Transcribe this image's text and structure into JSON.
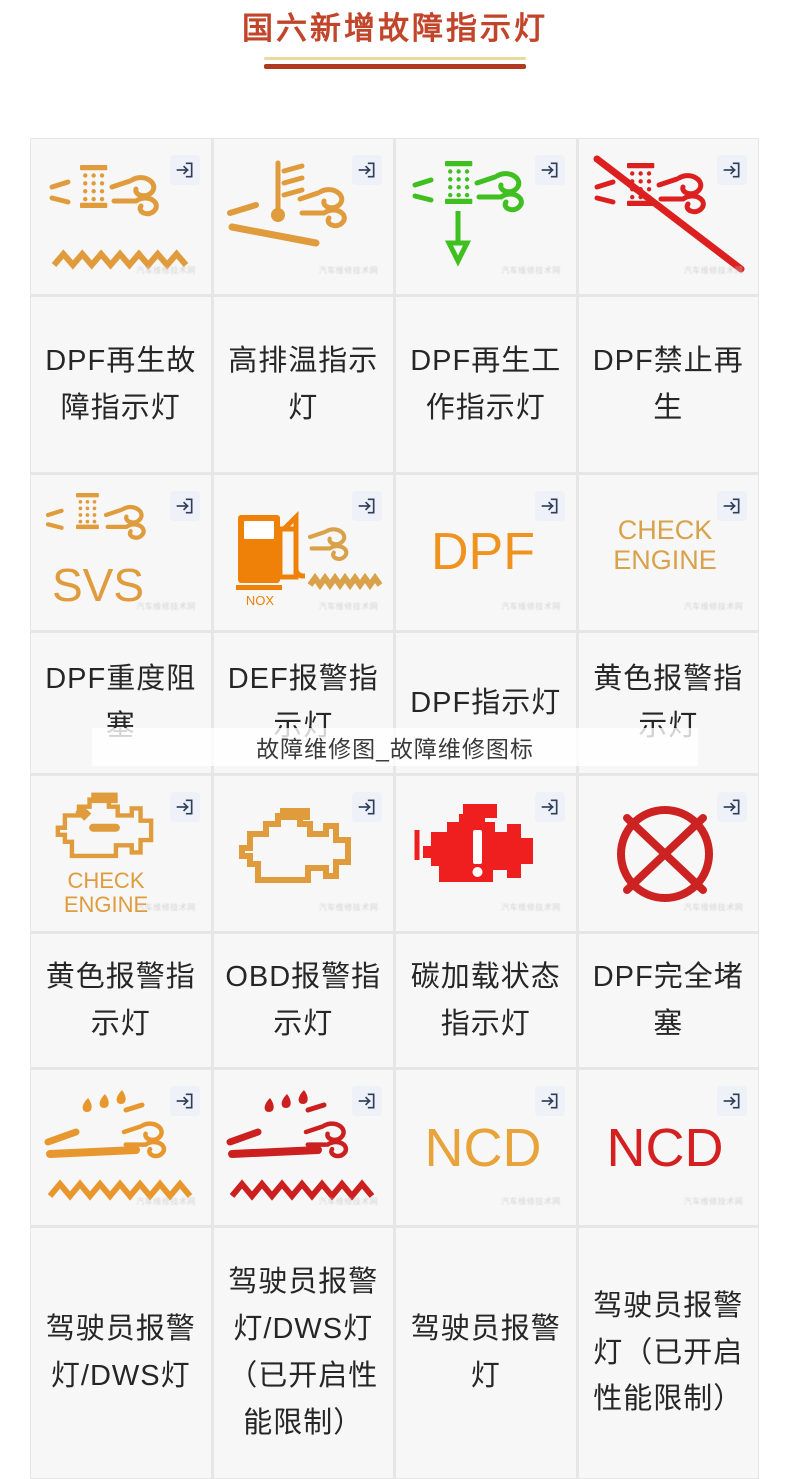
{
  "header": {
    "title": "国六新增故障指示灯",
    "accent_color": "#c1452a",
    "rule_top_color": "#ecd9a0",
    "rule_bottom_color": "#b03a20"
  },
  "overlay": {
    "text": "故障维修图_故障维修图标"
  },
  "watermark": {
    "text": "汽车维修技术网"
  },
  "icons": {
    "corner_badge_name": "import-arrow-icon"
  },
  "grid": {
    "columns": 4,
    "cells": [
      {
        "id": "r1c1",
        "label": "DPF再生故障指示灯",
        "icon": "dpf-filter-regen-fault-icon",
        "color": "#e09b3d"
      },
      {
        "id": "r1c2",
        "label": "高排温指示灯",
        "icon": "high-exhaust-temp-icon",
        "color": "#e09b3d"
      },
      {
        "id": "r1c3",
        "label": "DPF再生工作指示灯",
        "icon": "dpf-regen-active-icon",
        "color": "#3fbf20"
      },
      {
        "id": "r1c4",
        "label": "DPF禁止再生",
        "icon": "dpf-regen-inhibit-icon",
        "color": "#dc2020"
      },
      {
        "id": "r2c1",
        "label": "DPF重度阻塞",
        "icon": "svs-icon",
        "color": "#e09b3d",
        "text": "SVS"
      },
      {
        "id": "r2c2",
        "label": "DEF报警指示灯",
        "icon": "nox-def-pump-icon",
        "color": "#ef8008",
        "text": "NOX"
      },
      {
        "id": "r2c3",
        "label": "DPF指示灯",
        "icon": "dpf-text-icon",
        "color": "#f0921e",
        "text": "DPF"
      },
      {
        "id": "r2c4",
        "label": "黄色报警指示灯",
        "icon": "check-engine-text-icon",
        "color": "#d9a24a",
        "text": "CHECK ENGINE"
      },
      {
        "id": "r3c1",
        "label": "黄色报警指示灯",
        "icon": "check-engine-outline-icon",
        "color": "#e09b3d",
        "text": "CHECK ENGINE"
      },
      {
        "id": "r3c2",
        "label": "OBD报警指示灯",
        "icon": "obd-engine-outline-icon",
        "color": "#e09b3d"
      },
      {
        "id": "r3c3",
        "label": "碳加载状态指示灯",
        "icon": "engine-solid-alert-icon",
        "color": "#ef1f1f"
      },
      {
        "id": "r3c4",
        "label": "DPF完全堵塞",
        "icon": "circle-slash-icon",
        "color": "#cc2222"
      },
      {
        "id": "r4c1",
        "label": "驾驶员报警灯/DWS灯",
        "icon": "dws-amber-icon",
        "color": "#e8972e"
      },
      {
        "id": "r4c2",
        "label": "驾驶员报警灯/DWS灯（已开启性能限制）",
        "icon": "dws-red-icon",
        "color": "#cc1f1f"
      },
      {
        "id": "r4c3",
        "label": "驾驶员报警灯",
        "icon": "ncd-amber-text-icon",
        "color": "#e8a33a",
        "text": "NCD"
      },
      {
        "id": "r4c4",
        "label": "驾驶员报警灯（已开启性能限制）",
        "icon": "ncd-red-text-icon",
        "color": "#d42020",
        "text": "NCD"
      }
    ]
  }
}
